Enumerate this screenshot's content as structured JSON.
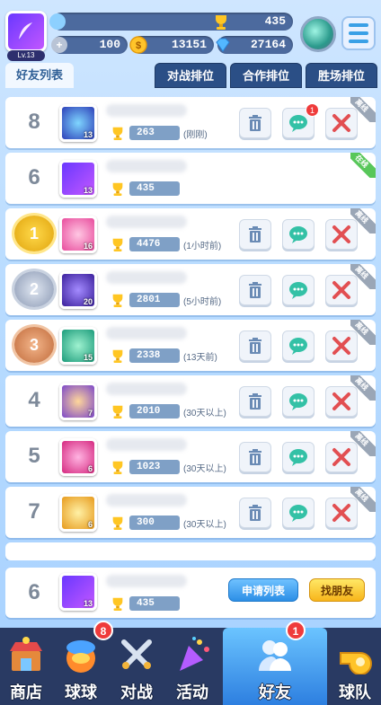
{
  "player": {
    "level": "Lv.13",
    "trophies": "435",
    "gold": "100",
    "coins": "13151",
    "gems": "27164"
  },
  "tabs": [
    {
      "label": "好友列表"
    },
    {
      "label": "对战排位"
    },
    {
      "label": "合作排位"
    },
    {
      "label": "胜场排位"
    }
  ],
  "friends": [
    {
      "rank": "8",
      "level": "13",
      "score": "263",
      "last": "(刚刚)",
      "status": "离线",
      "chat_badge": "1"
    },
    {
      "rank": "6",
      "level": "13",
      "score": "435",
      "last": "",
      "status": "在线",
      "chat_badge": ""
    },
    {
      "rank": "1",
      "level": "16",
      "score": "4476",
      "last": "(1小时前)",
      "status": "离线",
      "chat_badge": ""
    },
    {
      "rank": "2",
      "level": "20",
      "score": "2801",
      "last": "(5小时前)",
      "status": "离线",
      "chat_badge": ""
    },
    {
      "rank": "3",
      "level": "15",
      "score": "2338",
      "last": "(13天前)",
      "status": "离线",
      "chat_badge": ""
    },
    {
      "rank": "4",
      "level": "7",
      "score": "2010",
      "last": "(30天以上)",
      "status": "离线",
      "chat_badge": ""
    },
    {
      "rank": "5",
      "level": "6",
      "score": "1023",
      "last": "(30天以上)",
      "status": "离线",
      "chat_badge": ""
    },
    {
      "rank": "7",
      "level": "6",
      "score": "300",
      "last": "(30天以上)",
      "status": "离线",
      "chat_badge": ""
    }
  ],
  "self_row": {
    "rank": "6",
    "level": "13",
    "score": "435",
    "apply_label": "申请列表",
    "find_label": "找朋友"
  },
  "nav": [
    {
      "label": "商店",
      "badge": ""
    },
    {
      "label": "球球",
      "badge": "8"
    },
    {
      "label": "对战",
      "badge": ""
    },
    {
      "label": "活动",
      "badge": ""
    },
    {
      "label": "好友",
      "badge": "1"
    },
    {
      "label": "球队",
      "badge": ""
    }
  ],
  "colors": {
    "accent": "#2d7fe0",
    "chat": "#33c1a6",
    "delete": "#6a8bb5",
    "pk": "#e24f52"
  }
}
